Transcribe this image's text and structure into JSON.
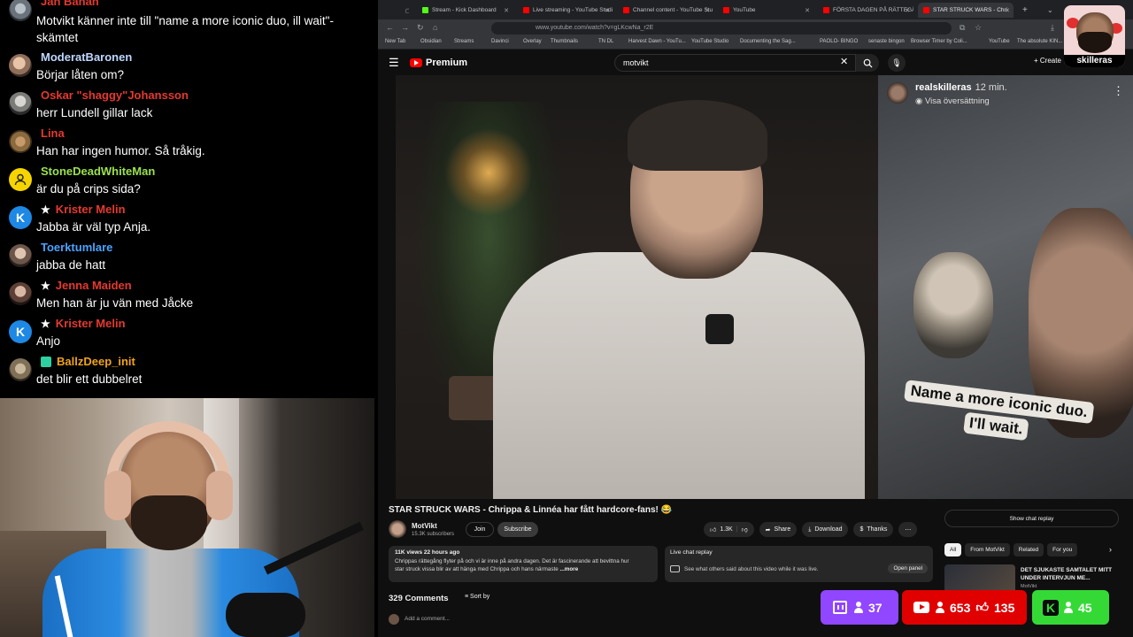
{
  "chat": {
    "top_cut": {
      "user": "Jan Banan",
      "user_color": "#e5392f",
      "text_line1": "Motvikt känner inte till \"name a more iconic duo, ill wait\"-",
      "text_line2": "skämtet"
    },
    "messages": [
      {
        "user": "ModeratBaronen",
        "user_color": "#bfd7ff",
        "text": "Börjar låten om?",
        "star": false,
        "avatar": "photo1"
      },
      {
        "user": "Oskar \"shaggy\"Johansson",
        "user_color": "#e5392f",
        "text": "herr Lundell gillar lack",
        "star": false,
        "avatar": "photo2"
      },
      {
        "user": "Lina",
        "user_color": "#e5392f",
        "text": "Han har ingen humor. Så tråkig.",
        "star": false,
        "avatar": "photo3"
      },
      {
        "user": "StoneDeadWhiteMan",
        "user_color": "#9be24b",
        "text": "är du på crips sida?",
        "star": false,
        "avatar": "yellow"
      },
      {
        "user": "Krister Melin",
        "user_color": "#e5392f",
        "text": "Jabba är väl typ Anja.",
        "star": true,
        "avatar": "k"
      },
      {
        "user": "Toerktumlare",
        "user_color": "#4aa3ff",
        "text": "jabba de hatt",
        "star": false,
        "avatar": "photo4"
      },
      {
        "user": "Jenna Maiden",
        "user_color": "#e5392f",
        "text": "Men han är ju vän med Jåcke",
        "star": true,
        "avatar": "photo5"
      },
      {
        "user": "Krister Melin",
        "user_color": "#e5392f",
        "text": "Anjo",
        "star": true,
        "avatar": "k"
      },
      {
        "user": "BallzDeep_init",
        "user_color": "#f0a31c",
        "text": "det blir ett dubbelret",
        "star": false,
        "avatar": "photo7",
        "badge": true
      }
    ],
    "k_letter": "K",
    "star_glyph": "★"
  },
  "browser": {
    "tabs": [
      {
        "label": "Stream - Kick Dashboard",
        "color": "#53fc18",
        "active": false
      },
      {
        "label": "Live streaming - YouTube Studi",
        "color": "#ff0000",
        "active": false
      },
      {
        "label": "Channel content - YouTube Stu",
        "color": "#ff0000",
        "active": false
      },
      {
        "label": "YouTube",
        "color": "#ff0000",
        "active": false
      },
      {
        "label": "FÖRSTA DAGEN PÅ RÄTTEGÅNI",
        "color": "#ff0000",
        "active": false
      },
      {
        "label": "STAR STRUCK WARS - Chri",
        "color": "#ff0000",
        "active": true
      }
    ],
    "url": "www.youtube.com/watch?v=gLKcwNa_r2E",
    "bookmarks": [
      "New Tab",
      "Obsidian",
      "Streams",
      "Davinci",
      "Overlay",
      "Thumbnails",
      "TN DL",
      "Harvest Dawn - YouTu...",
      "YouTube Studio",
      "Documenting the Sag...",
      "PAOLO- BINGO",
      "senaste bingon",
      "Browser Timer by Coli...",
      "YouTube",
      "The absolute KIN..."
    ]
  },
  "youtube": {
    "logo_text": "Premium",
    "search_value": "motvikt",
    "create_label": "+ Create",
    "video": {
      "overlay_user": "realskilleras",
      "overlay_time": "12 min.",
      "overlay_translate": "Visa översättning",
      "caption_line1": "Name a more iconic duo.",
      "caption_line2": "I'll wait."
    },
    "title": "STAR STRUCK WARS - Chrippa & Linnéa har fått hardcore-fans! 😂",
    "channel_name": "MotVikt",
    "subscribers": "15.3K subscribers",
    "join_label": "Join",
    "subscribe_label": "Subscribe",
    "likes": "1.3K",
    "share_label": "Share",
    "download_label": "Download",
    "thanks_label": "Thanks",
    "desc_meta": "11K views  22 hours ago",
    "desc_line1": "Chrippas rättegång flyter på och vi är inne på andra dagen. Det är fascinerande att bevittna hur",
    "desc_line2": "star struck vissa blir av att hänga med Chrippa och hans närmaste",
    "desc_more": "...more",
    "lcr_title": "Live chat replay",
    "lcr_sub": "See what others said about this video while it was live.",
    "lcr_open": "Open panel",
    "comments_count": "329 Comments",
    "sort_label": "Sort by",
    "add_comment": "Add a comment...",
    "show_chat_replay": "Show chat replay",
    "chips": [
      "All",
      "From MotVikt",
      "Related",
      "For you"
    ],
    "rec_title": "DET SJUKASTE SAMTALET MITT UNDER INTERVJUN ME...",
    "rec_channel": "MotVikt"
  },
  "sticker": {
    "label": "skilleras"
  },
  "counters": {
    "twitch": "37",
    "youtube_viewers": "653",
    "youtube_likes": "135",
    "kick": "45",
    "kick_letter": "K"
  }
}
